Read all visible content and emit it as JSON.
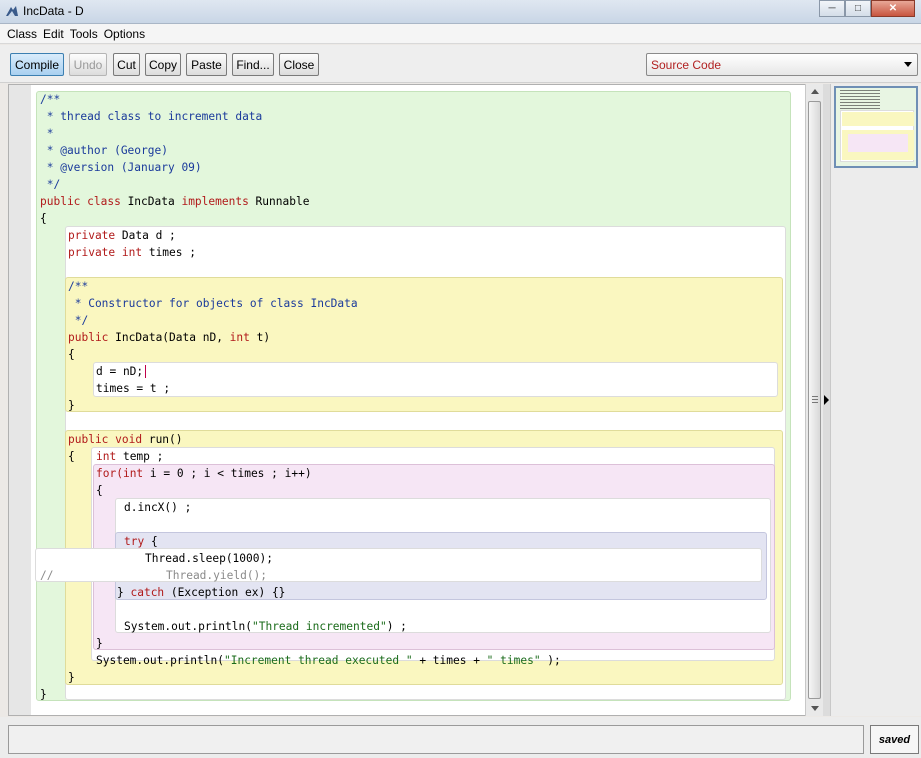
{
  "window": {
    "title": "IncData - D"
  },
  "menu": {
    "items": [
      "Class",
      "Edit",
      "Tools",
      "Options"
    ]
  },
  "toolbar": {
    "buttons": [
      "Compile",
      "Undo",
      "Cut",
      "Copy",
      "Paste",
      "Find...",
      "Close"
    ],
    "view_select": "Source Code"
  },
  "code": {
    "l1": "/**",
    "l2": " * thread class to increment data",
    "l3": " *",
    "l4": " * @author (George)",
    "l5": " * @version (January 09)",
    "l6": " */",
    "l7": {
      "a": "public class",
      "b": " IncData ",
      "c": "implements",
      "d": " Runnable"
    },
    "l8": "{",
    "l9": {
      "a": "private",
      "b": " Data d ;"
    },
    "l10": {
      "a": "private int",
      "b": " times ;"
    },
    "l11": "/**",
    "l12": " * Constructor for objects of class IncData",
    "l13": " */",
    "l14": {
      "a": "public",
      "b": " IncData(Data nD, ",
      "c": "int",
      "d": " t)"
    },
    "l15": "{",
    "l16": "d = nD;",
    "l17": "times = t ;",
    "l18": "}",
    "l19": {
      "a": "public void",
      "b": " run()"
    },
    "l20": {
      "a": "{",
      "b": "int",
      "c": " temp ;"
    },
    "l21": {
      "a": "for(",
      "b": "int",
      "c": " i = 0 ; i < times ; i++)"
    },
    "l22": "{",
    "l23": "d.incX() ;",
    "l24": {
      "a": "try",
      "b": " {"
    },
    "l25": "Thread.sleep(1000);",
    "l26": {
      "a": "//",
      "b": "Thread.yield();"
    },
    "l27": {
      "a": "} ",
      "b": "catch",
      "c": " (Exception ex) {}"
    },
    "l28": {
      "a": "System.out.println(",
      "b": "\"Thread incremented\"",
      "c": ") ;"
    },
    "l29": "}",
    "l30": {
      "a": "System.out.println(",
      "b": "\"Increment thread executed \"",
      "c": " + times + ",
      "d": "\" times\"",
      "e": " );"
    },
    "l31": "}",
    "l32": "}"
  },
  "status": {
    "message": "",
    "saved": "saved"
  },
  "colors": {
    "class_scope": "#e3f7dc",
    "method_scope": "#faf7c0",
    "loop_scope": "#f6e6f5",
    "try_scope": "#e3e4f2",
    "keyword": "#b11a1a",
    "comment": "#1a3a9b",
    "string": "#1a6b1a"
  }
}
